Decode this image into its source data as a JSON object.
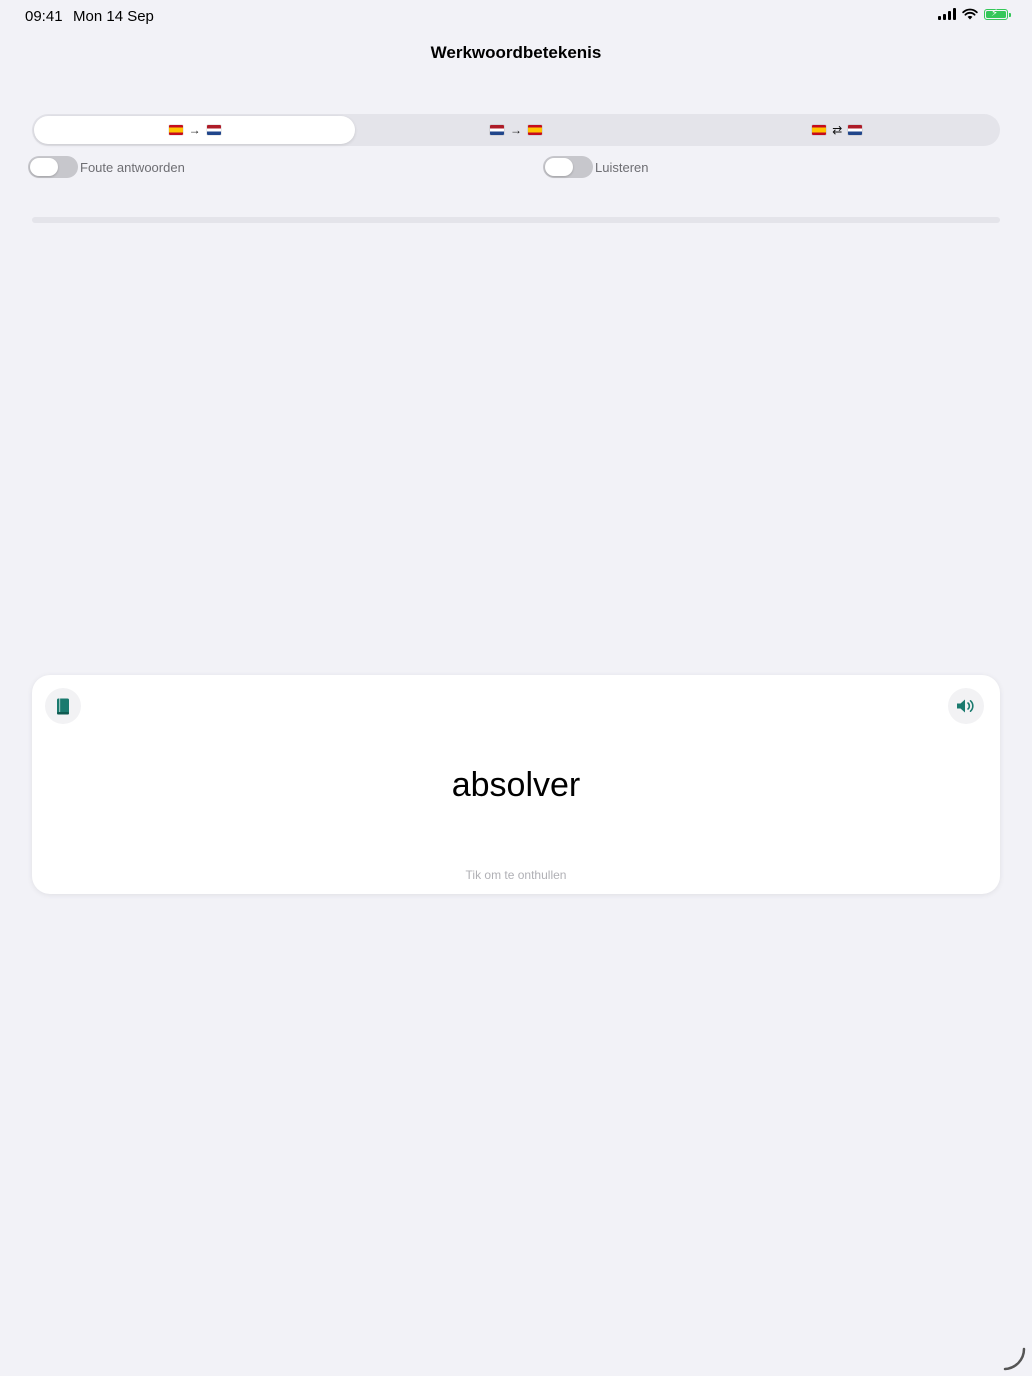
{
  "status_bar": {
    "time": "09:41",
    "date": "Mon 14 Sep",
    "battery_color": "#34c759"
  },
  "nav": {
    "title": "Werkwoordbetekenis"
  },
  "direction_segments": [
    {
      "from_flag": "spain-flag-icon",
      "arrow": "→",
      "to_flag": "netherlands-flag-icon",
      "selected": true
    },
    {
      "from_flag": "netherlands-flag-icon",
      "arrow": "→",
      "to_flag": "spain-flag-icon",
      "selected": false
    },
    {
      "from_flag": "spain-flag-icon",
      "arrow": "⇄",
      "to_flag": "netherlands-flag-icon",
      "selected": false
    }
  ],
  "toggles": {
    "wrong_answers": {
      "label": "Foute antwoorden",
      "on": false
    },
    "listen": {
      "label": "Luisteren",
      "on": false
    }
  },
  "progress": {
    "fraction": 0.0
  },
  "card": {
    "word": "absolver",
    "hint": "Tik om te onthullen",
    "left_icon": "book-icon",
    "right_icon": "speaker-icon",
    "accent_color": "#1a7a6e"
  }
}
